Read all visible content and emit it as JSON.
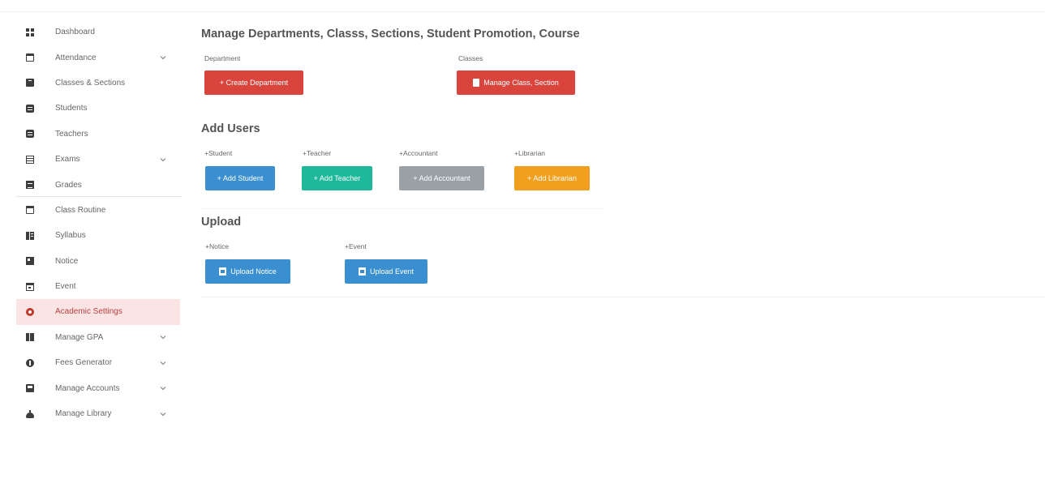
{
  "sidebar": {
    "items": [
      {
        "label": "Dashboard",
        "icon": "dashboard-icon",
        "has_chevron": false,
        "active": false
      },
      {
        "label": "Attendance",
        "icon": "calendar-icon",
        "has_chevron": true,
        "active": false
      },
      {
        "label": "Classes & Sections",
        "icon": "book-icon",
        "has_chevron": false,
        "active": false
      },
      {
        "label": "Students",
        "icon": "id-card-icon",
        "has_chevron": false,
        "active": false
      },
      {
        "label": "Teachers",
        "icon": "id-card-icon",
        "has_chevron": false,
        "active": false
      },
      {
        "label": "Exams",
        "icon": "table-icon",
        "has_chevron": true,
        "active": false
      },
      {
        "label": "Grades",
        "icon": "document-icon",
        "has_chevron": false,
        "active": false
      },
      {
        "label": "Class Routine",
        "icon": "calendar-icon",
        "has_chevron": false,
        "active": false
      },
      {
        "label": "Syllabus",
        "icon": "film-icon",
        "has_chevron": false,
        "active": false
      },
      {
        "label": "Notice",
        "icon": "bullhorn-icon",
        "has_chevron": false,
        "active": false
      },
      {
        "label": "Event",
        "icon": "event-calendar-icon",
        "has_chevron": false,
        "active": false
      },
      {
        "label": "Academic Settings",
        "icon": "gear-icon",
        "has_chevron": false,
        "active": true
      },
      {
        "label": "Manage GPA",
        "icon": "gpa-icon",
        "has_chevron": true,
        "active": false
      },
      {
        "label": "Fees Generator",
        "icon": "fees-icon",
        "has_chevron": true,
        "active": false
      },
      {
        "label": "Manage Accounts",
        "icon": "accounts-icon",
        "has_chevron": true,
        "active": false
      },
      {
        "label": "Manage Library",
        "icon": "library-icon",
        "has_chevron": true,
        "active": false
      }
    ]
  },
  "main": {
    "title": "Manage Departments, Classs, Sections, Student Promotion, Course",
    "department": {
      "label": "Department",
      "button": "+ Create Department"
    },
    "classes": {
      "label": "Classes",
      "button": "Manage Class, Section"
    },
    "add_users": {
      "heading": "Add Users",
      "student": {
        "label": "+Student",
        "button": "+ Add Student"
      },
      "teacher": {
        "label": "+Teacher",
        "button": "+ Add Teacher"
      },
      "accountant": {
        "label": "+Accountant",
        "button": "+ Add Accountant"
      },
      "librarian": {
        "label": "+Librarian",
        "button": "+ Add Librarian"
      }
    },
    "upload": {
      "heading": "Upload",
      "notice": {
        "label": "+Notice",
        "button": "Upload Notice"
      },
      "event": {
        "label": "+Event",
        "button": "Upload Event"
      }
    }
  },
  "colors": {
    "red": "#d9453d",
    "blue": "#3a8fd0",
    "teal": "#1eb99a",
    "gray": "#9aa1a6",
    "orange": "#f0a01e",
    "active_bg": "#fbe4e4"
  }
}
